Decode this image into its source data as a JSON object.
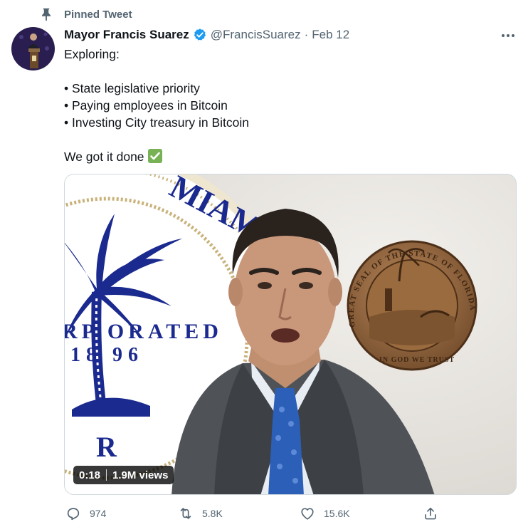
{
  "pinned": {
    "label": "Pinned Tweet",
    "icon": "pin-icon"
  },
  "author": {
    "display_name": "Mayor Francis Suarez",
    "handle": "@FrancisSuarez",
    "separator": "·",
    "date": "Feb 12",
    "verified": true
  },
  "tweet": {
    "text": "Exploring:\n\n• State legislative priority\n• Paying employees in Bitcoin\n• Investing City treasury in Bitcoin\n\nWe got it done",
    "emoji": "check-mark-icon"
  },
  "video": {
    "time": "0:18",
    "views": "1.9M views",
    "seal_text_left": "RP ORATED",
    "seal_year": "18 96",
    "seal_text_top": "MIAM",
    "seal_text_bottom": "R",
    "florida_seal_top": "GREAT SEAL OF THE STATE OF FLORIDA",
    "florida_seal_bottom": "IN GOD WE TRUST"
  },
  "actions": {
    "reply_count": "974",
    "retweet_count": "5.8K",
    "like_count": "15.6K"
  },
  "colors": {
    "accent": "#1d9bf0",
    "muted": "#536471",
    "text": "#0f1419"
  }
}
